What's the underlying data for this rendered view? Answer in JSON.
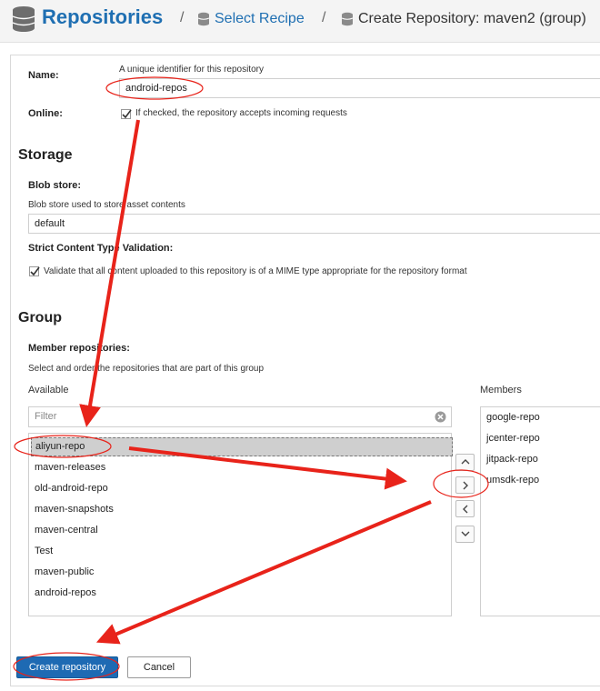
{
  "header": {
    "title": "Repositories",
    "separator": "/",
    "crumb_select_recipe": "Select Recipe",
    "crumb_create": "Create Repository: maven2 (group)",
    "accent": "#1f6fb2"
  },
  "form": {
    "name_label": "Name:",
    "name_help": "A unique identifier for this repository",
    "name_value": "android-repos",
    "online_label": "Online:",
    "online_checked": true,
    "online_help": "If checked, the repository accepts incoming requests"
  },
  "storage": {
    "title": "Storage",
    "blob_store_label": "Blob store:",
    "blob_store_help": "Blob store used to store asset contents",
    "blob_store_value": "default",
    "strict_label": "Strict Content Type Validation:",
    "strict_checked": true,
    "strict_help": "Validate that all content uploaded to this repository is of a MIME type appropriate for the repository format"
  },
  "group": {
    "title": "Group",
    "member_label": "Member repositories:",
    "member_help": "Select and order the repositories that are part of this group",
    "available_label": "Available",
    "members_label": "Members",
    "filter_placeholder": "Filter",
    "available": [
      "aliyun-repo",
      "maven-releases",
      "old-android-repo",
      "maven-snapshots",
      "maven-central",
      "Test",
      "maven-public",
      "android-repos"
    ],
    "members": [
      "google-repo",
      "jcenter-repo",
      "jitpack-repo",
      "umsdk-repo"
    ],
    "selected_available": "aliyun-repo"
  },
  "buttons": {
    "create": "Create repository",
    "cancel": "Cancel",
    "primary_color": "#1e6ab3"
  },
  "annotations": {
    "color": "#e8231a"
  }
}
